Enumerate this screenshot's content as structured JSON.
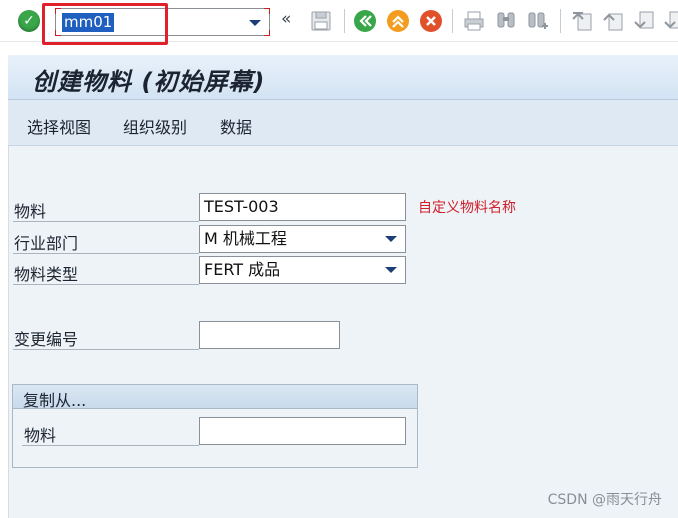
{
  "toolbar": {
    "command_value": "mm01",
    "nav_glyph": "«",
    "icons": [
      "enter-icon",
      "save-icon",
      "back-icon",
      "exit-icon",
      "cancel-icon",
      "print-icon",
      "find-icon",
      "find-next-icon",
      "first-page-icon",
      "previous-page-icon",
      "next-page-icon",
      "last-page-icon"
    ]
  },
  "screen": {
    "title": "创建物料 (初始屏幕)"
  },
  "app_toolbar": {
    "buttons": [
      "选择视图",
      "组织级别",
      "数据"
    ]
  },
  "form": {
    "material": {
      "label": "物料",
      "value": "TEST-003"
    },
    "industry": {
      "label": "行业部门",
      "value": "M 机械工程"
    },
    "material_type": {
      "label": "物料类型",
      "value": "FERT 成品"
    },
    "change_number": {
      "label": "变更编号",
      "value": ""
    },
    "annotation": "自定义物料名称"
  },
  "copy_from": {
    "title": "复制从...",
    "material_label": "物料",
    "material_value": ""
  },
  "watermark": "CSDN @雨天行舟",
  "colors": {
    "accent_blue": "#1f5fbf",
    "highlight_red": "#e0202a",
    "annotation_red": "#d0202a",
    "enter_green": "#3aa64a"
  }
}
